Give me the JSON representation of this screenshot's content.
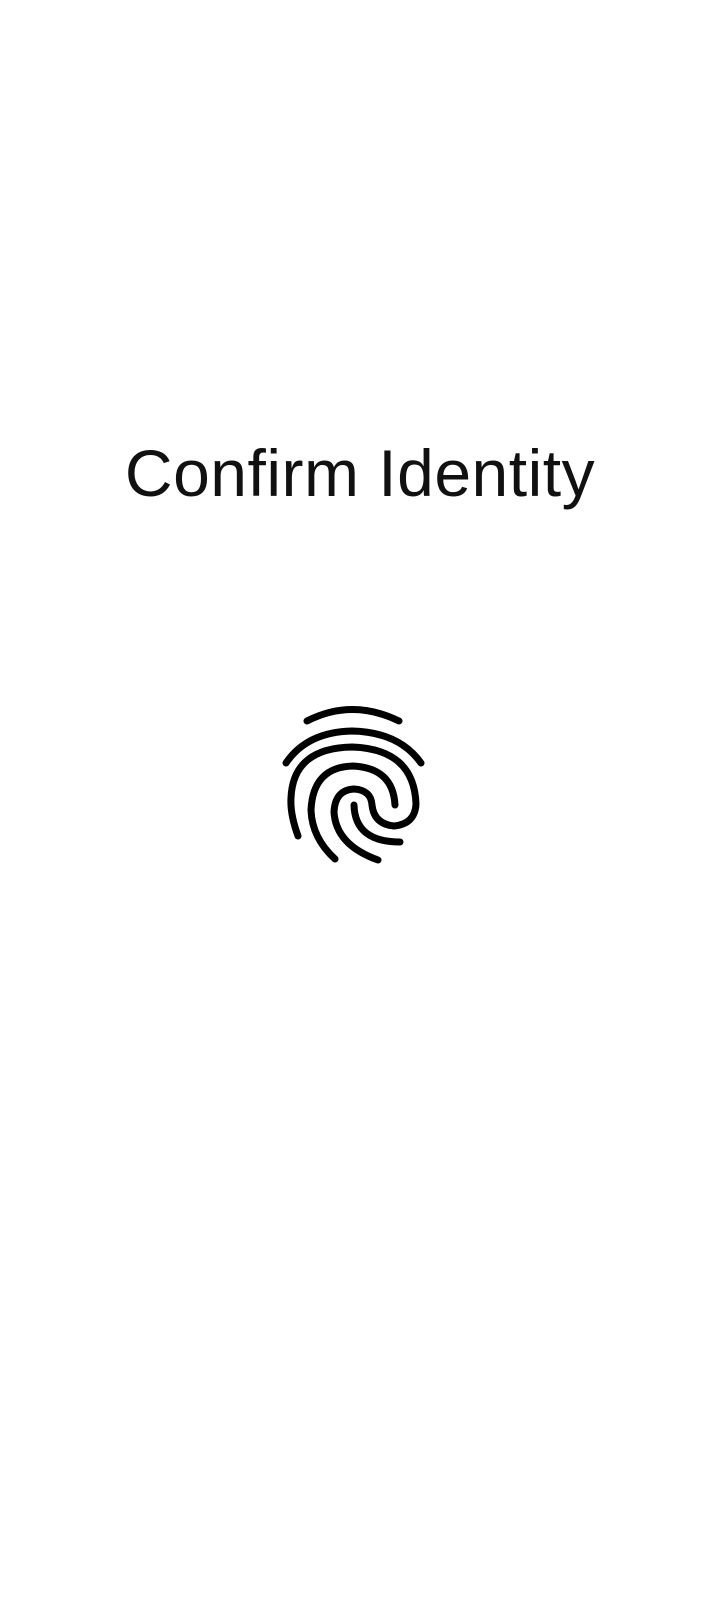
{
  "screen": {
    "title": "Confirm Identity"
  },
  "fingerprint": {
    "icon": "fingerprint-icon",
    "color": "#000000"
  }
}
